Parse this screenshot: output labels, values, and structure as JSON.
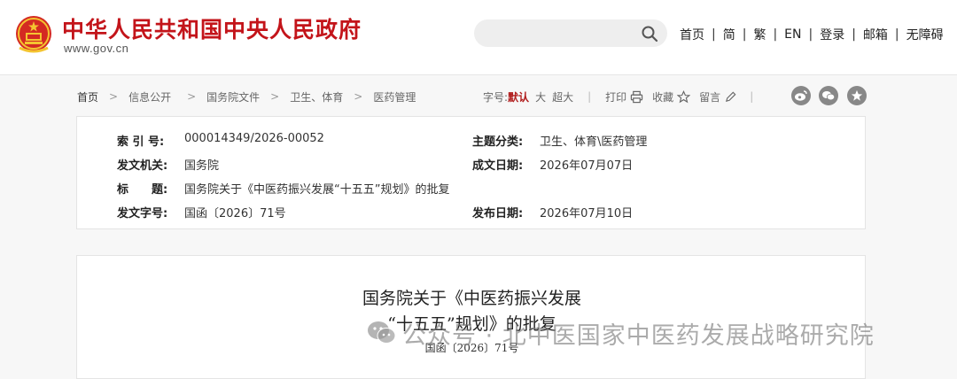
{
  "header": {
    "site_title": "中华人民共和国中央人民政府",
    "domain": "www.gov.cn",
    "search_placeholder": "",
    "nav": [
      "首页",
      "简",
      "繁",
      "EN",
      "登录",
      "邮箱",
      "无障碍"
    ]
  },
  "breadcrumb": [
    "首页",
    "信息公开",
    "国务院文件",
    "卫生、体育",
    "医药管理"
  ],
  "tools": {
    "font_size_label": "字号:",
    "font_sizes": [
      "默认",
      "大",
      "超大"
    ],
    "print": "打印",
    "favorite": "收藏",
    "comment": "留言"
  },
  "info": {
    "index_label": "索 引 号:",
    "index_value": "000014349/2026-00052",
    "topic_label": "主题分类:",
    "topic_value": "卫生、体育\\医药管理",
    "issuer_label": "发文机关:",
    "issuer_value": "国务院",
    "created_label": "成文日期:",
    "created_value": "2026年07月07日",
    "title_label": "标　　题:",
    "title_value": "国务院关于《中医药振兴发展“十五五”规划》的批复",
    "docno_label": "发文字号:",
    "docno_value": "国函〔2026〕71号",
    "published_label": "发布日期:",
    "published_value": "2026年07月10日"
  },
  "article": {
    "title_line1": "国务院关于《中医药振兴发展",
    "title_line2": "“十五五”规划》的批复",
    "doc_number": "国函〔2026〕71号"
  },
  "watermark": {
    "text": "公众号 · 北中医国家中医药发展战略研究院"
  },
  "colors": {
    "brand_red": "#c3141a",
    "active_size": "#b01b1b"
  }
}
